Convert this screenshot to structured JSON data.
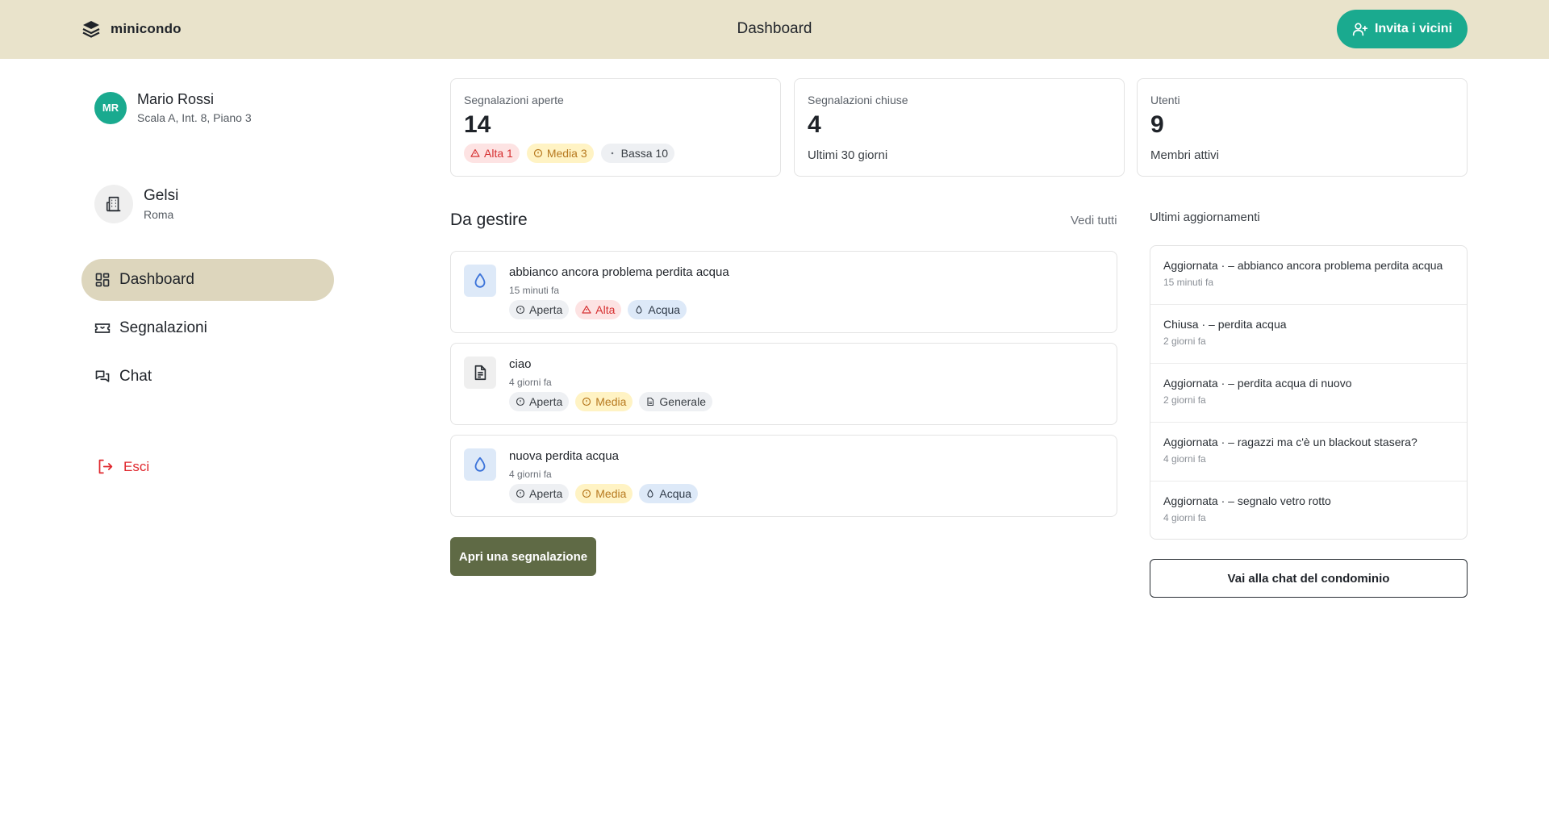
{
  "app": {
    "name": "minicondo",
    "page_title": "Dashboard"
  },
  "header": {
    "invite_label": "Invita i vicini"
  },
  "profile": {
    "initials": "MR",
    "name": "Mario Rossi",
    "address": "Scala A, Int. 8, Piano 3"
  },
  "condo": {
    "name": "Gelsi",
    "city": "Roma"
  },
  "nav": {
    "items": [
      {
        "label": "Dashboard",
        "icon": "dashboard-icon",
        "active": true
      },
      {
        "label": "Segnalazioni",
        "icon": "ticket-icon",
        "active": false
      },
      {
        "label": "Chat",
        "icon": "chat-icon",
        "active": false
      }
    ],
    "logout": "Esci"
  },
  "stats": {
    "open": {
      "label": "Segnalazioni aperte",
      "value": "14",
      "tags": {
        "high": "Alta 1",
        "medium": "Media 3",
        "low": "Bassa 10"
      }
    },
    "closed": {
      "label": "Segnalazioni chiuse",
      "value": "4",
      "sub": "Ultimi 30 giorni"
    },
    "users": {
      "label": "Utenti",
      "value": "9",
      "sub": "Membri attivi"
    }
  },
  "todo": {
    "title": "Da gestire",
    "see_all": "Vedi tutti",
    "items": [
      {
        "title": "abbianco ancora problema perdita acqua",
        "time": "15 minuti fa",
        "status": "Aperta",
        "priority": "Alta",
        "category": "Acqua",
        "icon": "water-drop-icon"
      },
      {
        "title": "ciao",
        "time": "4 giorni fa",
        "status": "Aperta",
        "priority": "Media",
        "category": "Generale",
        "icon": "document-icon"
      },
      {
        "title": "nuova perdita acqua",
        "time": "4 giorni fa",
        "status": "Aperta",
        "priority": "Media",
        "category": "Acqua",
        "icon": "water-drop-icon"
      }
    ],
    "open_button": "Apri una segnalazione"
  },
  "updates": {
    "title": "Ultimi aggiornamenti",
    "items": [
      {
        "text": "Aggiornata · – abbianco ancora problema perdita acqua",
        "time": "15 minuti fa"
      },
      {
        "text": "Chiusa · – perdita acqua",
        "time": "2 giorni fa"
      },
      {
        "text": "Aggiornata · – perdita acqua di nuovo",
        "time": "2 giorni fa"
      },
      {
        "text": "Aggiornata · – ragazzi ma c'è un blackout stasera?",
        "time": "4 giorni fa"
      },
      {
        "text": "Aggiornata · – segnalo vetro rotto",
        "time": "4 giorni fa"
      }
    ],
    "chat_button": "Vai alla chat del condominio"
  },
  "colors": {
    "topbar": "#e9e3cb",
    "accent": "#1aaa8f",
    "primary_button": "#5f6a45",
    "nav_active": "#ddd6bd",
    "danger": "#e0282e"
  }
}
